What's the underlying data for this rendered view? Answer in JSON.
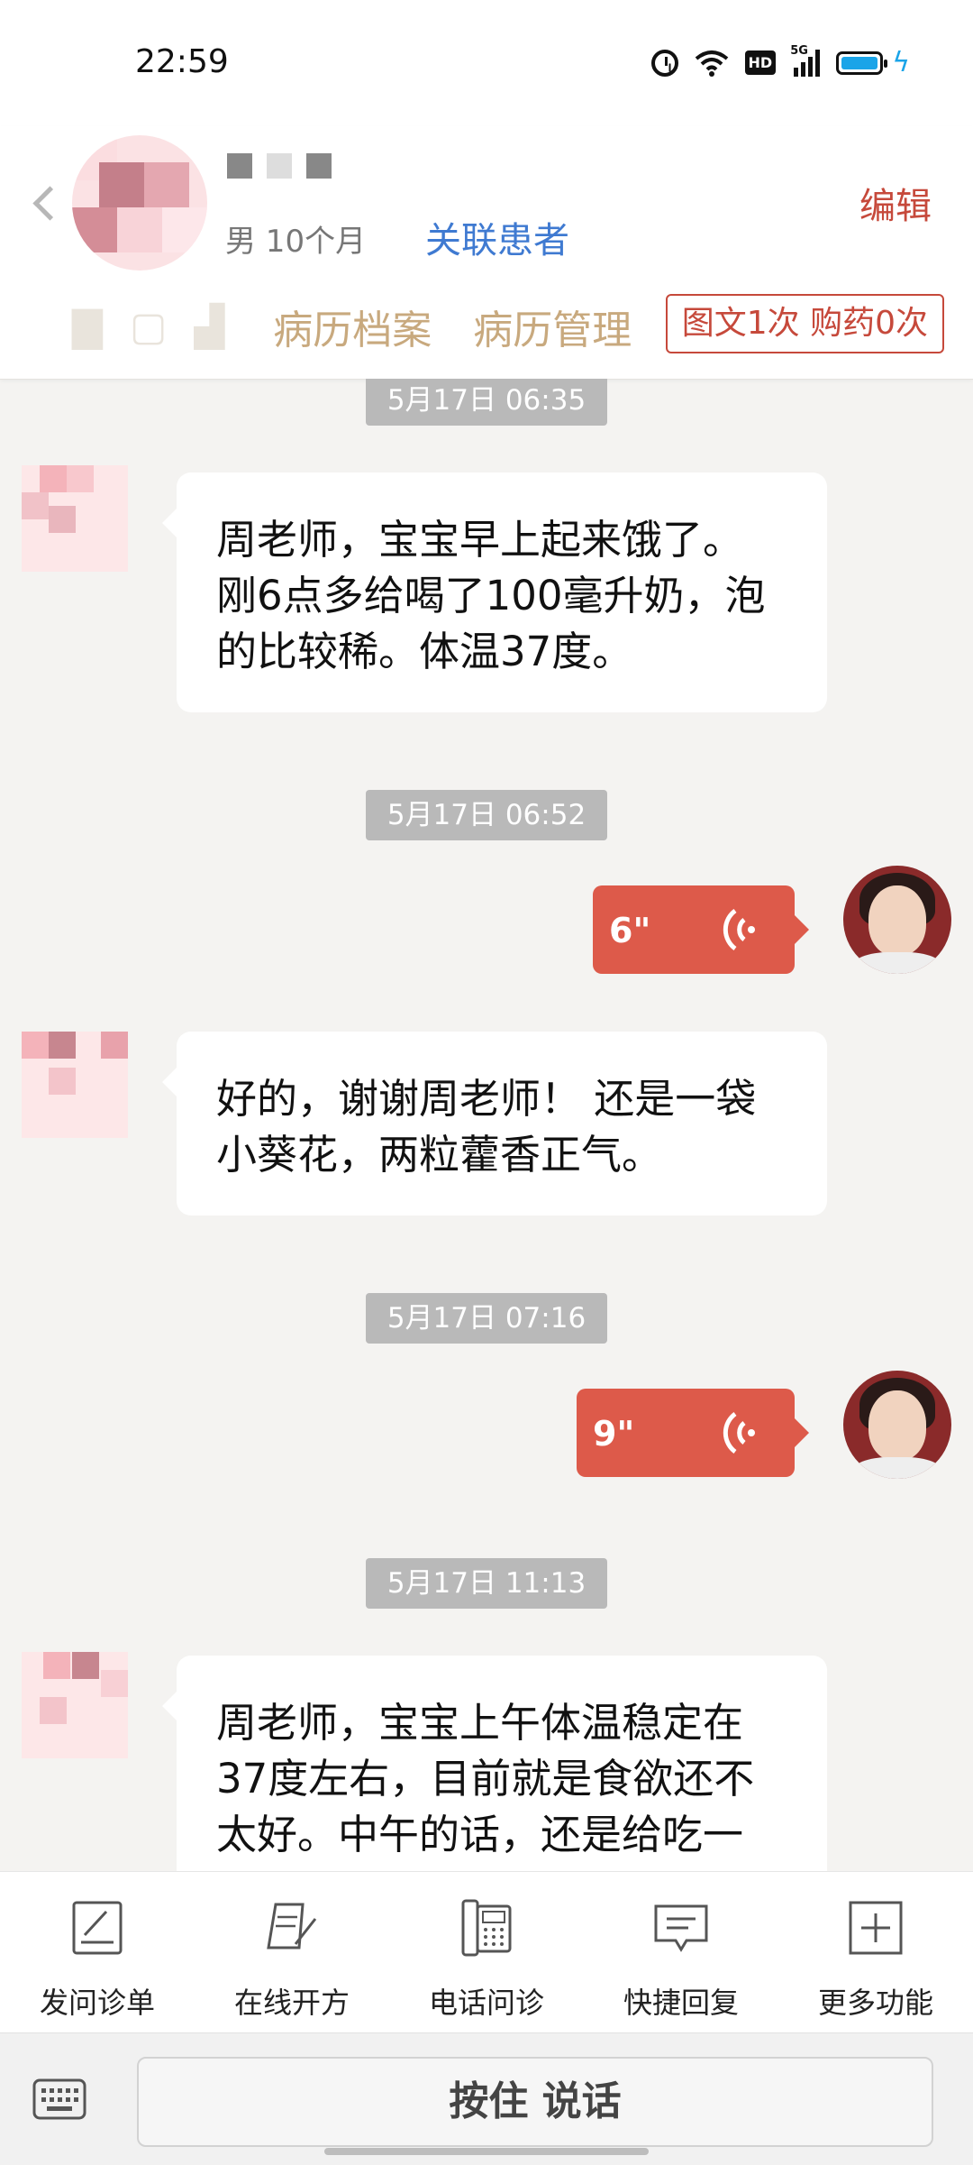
{
  "status_bar": {
    "time": "22:59",
    "hd": "HD",
    "network": "5G"
  },
  "header": {
    "patient_meta": "男 10个月",
    "link_patient": "关联患者",
    "edit": "编辑",
    "tabs": [
      "病历档案",
      "病历管理"
    ],
    "count_chip": "图文1次 购药0次"
  },
  "messages": [
    {
      "type": "timestamp",
      "text": "5月17日 06:35"
    },
    {
      "type": "incoming_text",
      "lines": [
        "周老师，宝宝早上起来饿了。",
        "刚6点多给喝了100毫升奶，泡",
        "的比较稀。体温37度。"
      ]
    },
    {
      "type": "timestamp",
      "text": "5月17日 06:52"
    },
    {
      "type": "outgoing_voice",
      "duration": "6\""
    },
    {
      "type": "incoming_text",
      "lines": [
        "好的，谢谢周老师！  还是一袋",
        "小葵花，两粒藿香正气。"
      ]
    },
    {
      "type": "timestamp",
      "text": "5月17日 07:16"
    },
    {
      "type": "outgoing_voice",
      "duration": "9\""
    },
    {
      "type": "timestamp",
      "text": "5月17日 11:13"
    },
    {
      "type": "incoming_text",
      "lines": [
        "周老师，宝宝上午体温稳定在",
        "37度左右，目前就是食欲还不",
        "太好。中午的话，还是给吃一"
      ]
    }
  ],
  "toolbar": [
    {
      "label": "发问诊单",
      "icon": "form-pen-icon"
    },
    {
      "label": "在线开方",
      "icon": "prescription-icon"
    },
    {
      "label": "电话问诊",
      "icon": "phone-icon"
    },
    {
      "label": "快捷回复",
      "icon": "quick-reply-icon"
    },
    {
      "label": "更多功能",
      "icon": "plus-box-icon"
    }
  ],
  "input_bar": {
    "hold_to_talk": "按住 说话",
    "icon": "keyboard-icon"
  },
  "colors": {
    "accent": "#dd5a4a",
    "link": "#3f7ad1",
    "tab": "#c8a97e",
    "chip": "#c6493b"
  }
}
